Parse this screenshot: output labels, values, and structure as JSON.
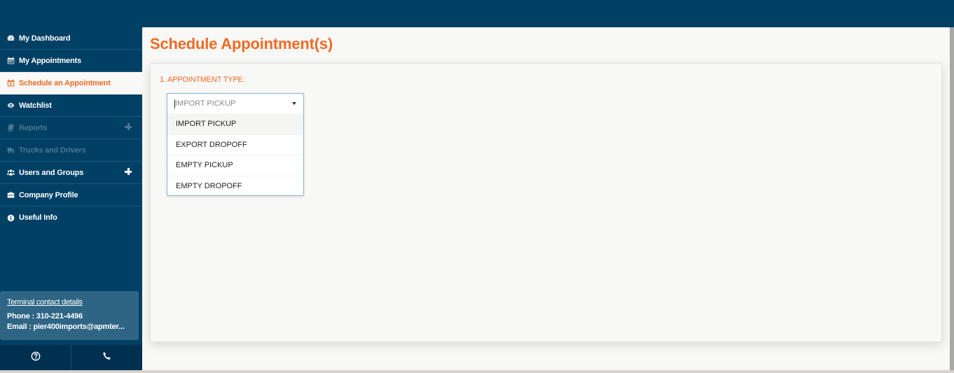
{
  "sidebar": {
    "items": [
      {
        "label": "My Dashboard",
        "icon": "dashboard-icon",
        "state": "normal",
        "expandable": false
      },
      {
        "label": "My Appointments",
        "icon": "calendar-icon",
        "state": "normal",
        "expandable": false
      },
      {
        "label": "Schedule an Appointment",
        "icon": "calendar-plus-icon",
        "state": "active",
        "expandable": false
      },
      {
        "label": "Watchlist",
        "icon": "eye-icon",
        "state": "normal",
        "expandable": false
      },
      {
        "label": "Reports",
        "icon": "book-icon",
        "state": "disabled",
        "expandable": true
      },
      {
        "label": "Trucks and Drivers",
        "icon": "truck-icon",
        "state": "disabled",
        "expandable": false
      },
      {
        "label": "Users and Groups",
        "icon": "users-icon",
        "state": "normal",
        "expandable": true
      },
      {
        "label": "Company Profile",
        "icon": "briefcase-icon",
        "state": "normal",
        "expandable": false
      },
      {
        "label": "Useful Info",
        "icon": "info-icon",
        "state": "normal",
        "expandable": false
      }
    ],
    "contact": {
      "title": "Terminal contact details",
      "phone": "Phone : 310-221-4496",
      "email": "Email : pier400imports@apmter..."
    },
    "bottom_buttons": [
      {
        "icon": "help-icon"
      },
      {
        "icon": "phone-icon"
      }
    ]
  },
  "main": {
    "title": "Schedule Appointment(s)",
    "section_label": "1. APPOINTMENT TYPE:",
    "appointment_type_select": {
      "placeholder": "IMPORT PICKUP",
      "expanded": true,
      "highlighted_index": 0,
      "options": [
        "IMPORT PICKUP",
        "EXPORT DROPOFF",
        "EMPTY PICKUP",
        "EMPTY DROPOFF"
      ]
    }
  },
  "colors": {
    "header_bg": "#004065",
    "accent": "#f06a25",
    "active_bg": "#f8f8f6",
    "disabled_text": "#4d7790",
    "contact_box_bg": "#2e6585"
  }
}
